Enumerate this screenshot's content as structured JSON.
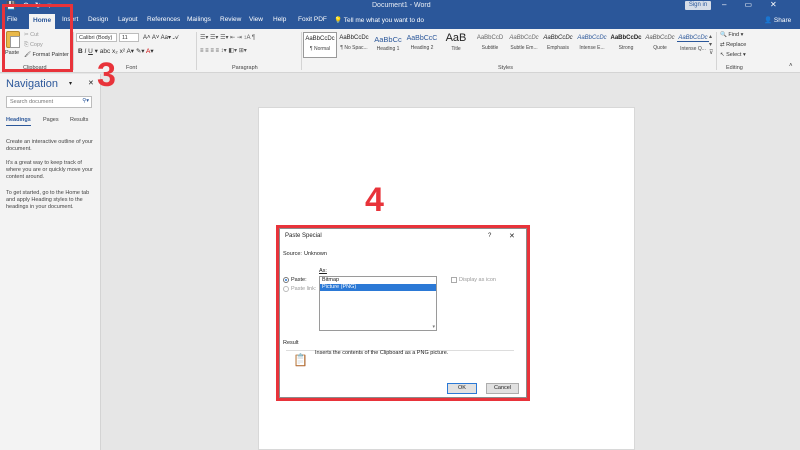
{
  "titlebar": {
    "qat": [
      "💾",
      "↶",
      "↻",
      "▾"
    ],
    "doc_title": "Document1 - Word",
    "sign_in": "Sign in",
    "controls": [
      "–",
      "▭",
      "✕"
    ]
  },
  "tabs": {
    "items": [
      "File",
      "Home",
      "Insert",
      "Design",
      "Layout",
      "References",
      "Mailings",
      "Review",
      "View",
      "Help",
      "Foxit PDF"
    ],
    "tell_me": "Tell me what you want to do",
    "share": "Share"
  },
  "clipboard": {
    "paste": "Paste",
    "cut": "Cut",
    "copy": "Copy",
    "format_painter": "Format Painter",
    "group_label": "Clipboard"
  },
  "font": {
    "font_name": "Calibri (Body)",
    "font_size": "11",
    "group_label": "Font"
  },
  "paragraph": {
    "group_label": "Paragraph"
  },
  "styles": {
    "items": [
      {
        "preview": "AaBbCcDc",
        "name": "¶ Normal"
      },
      {
        "preview": "AaBbCcDc",
        "name": "¶ No Spac..."
      },
      {
        "preview": "AaBbCc",
        "name": "Heading 1"
      },
      {
        "preview": "AaBbCcC",
        "name": "Heading 2"
      },
      {
        "preview": "AaB",
        "name": "Title"
      },
      {
        "preview": "AaBbCcD",
        "name": "Subtitle"
      },
      {
        "preview": "AaBbCcDc",
        "name": "Subtle Em..."
      },
      {
        "preview": "AaBbCcDc",
        "name": "Emphasis"
      },
      {
        "preview": "AaBbCcDc",
        "name": "Intense E..."
      },
      {
        "preview": "AaBbCcDc",
        "name": "Strong"
      },
      {
        "preview": "AaBbCcDc",
        "name": "Quote"
      },
      {
        "preview": "AaBbCcDc",
        "name": "Intense Q..."
      }
    ],
    "group_label": "Styles"
  },
  "editing": {
    "find": "Find",
    "replace": "Replace",
    "select": "Select",
    "group_label": "Editing"
  },
  "callouts": {
    "step3": "3",
    "step4": "4"
  },
  "navigation": {
    "title": "Navigation",
    "search_placeholder": "Search document",
    "tabs": [
      "Headings",
      "Pages",
      "Results"
    ],
    "para1": "Create an interactive outline of your document.",
    "para2": "It's a great way to keep track of where you are or quickly move your content around.",
    "para3": "To get started, go to the Home tab and apply Heading styles to the headings in your document."
  },
  "dialog": {
    "title": "Paste Special",
    "help": "?",
    "close": "✕",
    "source_label": "Source:",
    "source_value": "Unknown",
    "as_label": "As:",
    "paste_option": "Paste:",
    "paste_link_option": "Paste link:",
    "list_items": [
      "Bitmap",
      "Picture (PNG)"
    ],
    "selected_index": 1,
    "display_as_icon": "Display as icon",
    "result_label": "Result",
    "result_text": "Inserts the contents of the Clipboard as a PNG picture.",
    "ok": "OK",
    "cancel": "Cancel"
  },
  "colors": {
    "word_blue": "#2b579a",
    "highlight_red": "#e8333a",
    "selection_blue": "#2b79d6"
  }
}
